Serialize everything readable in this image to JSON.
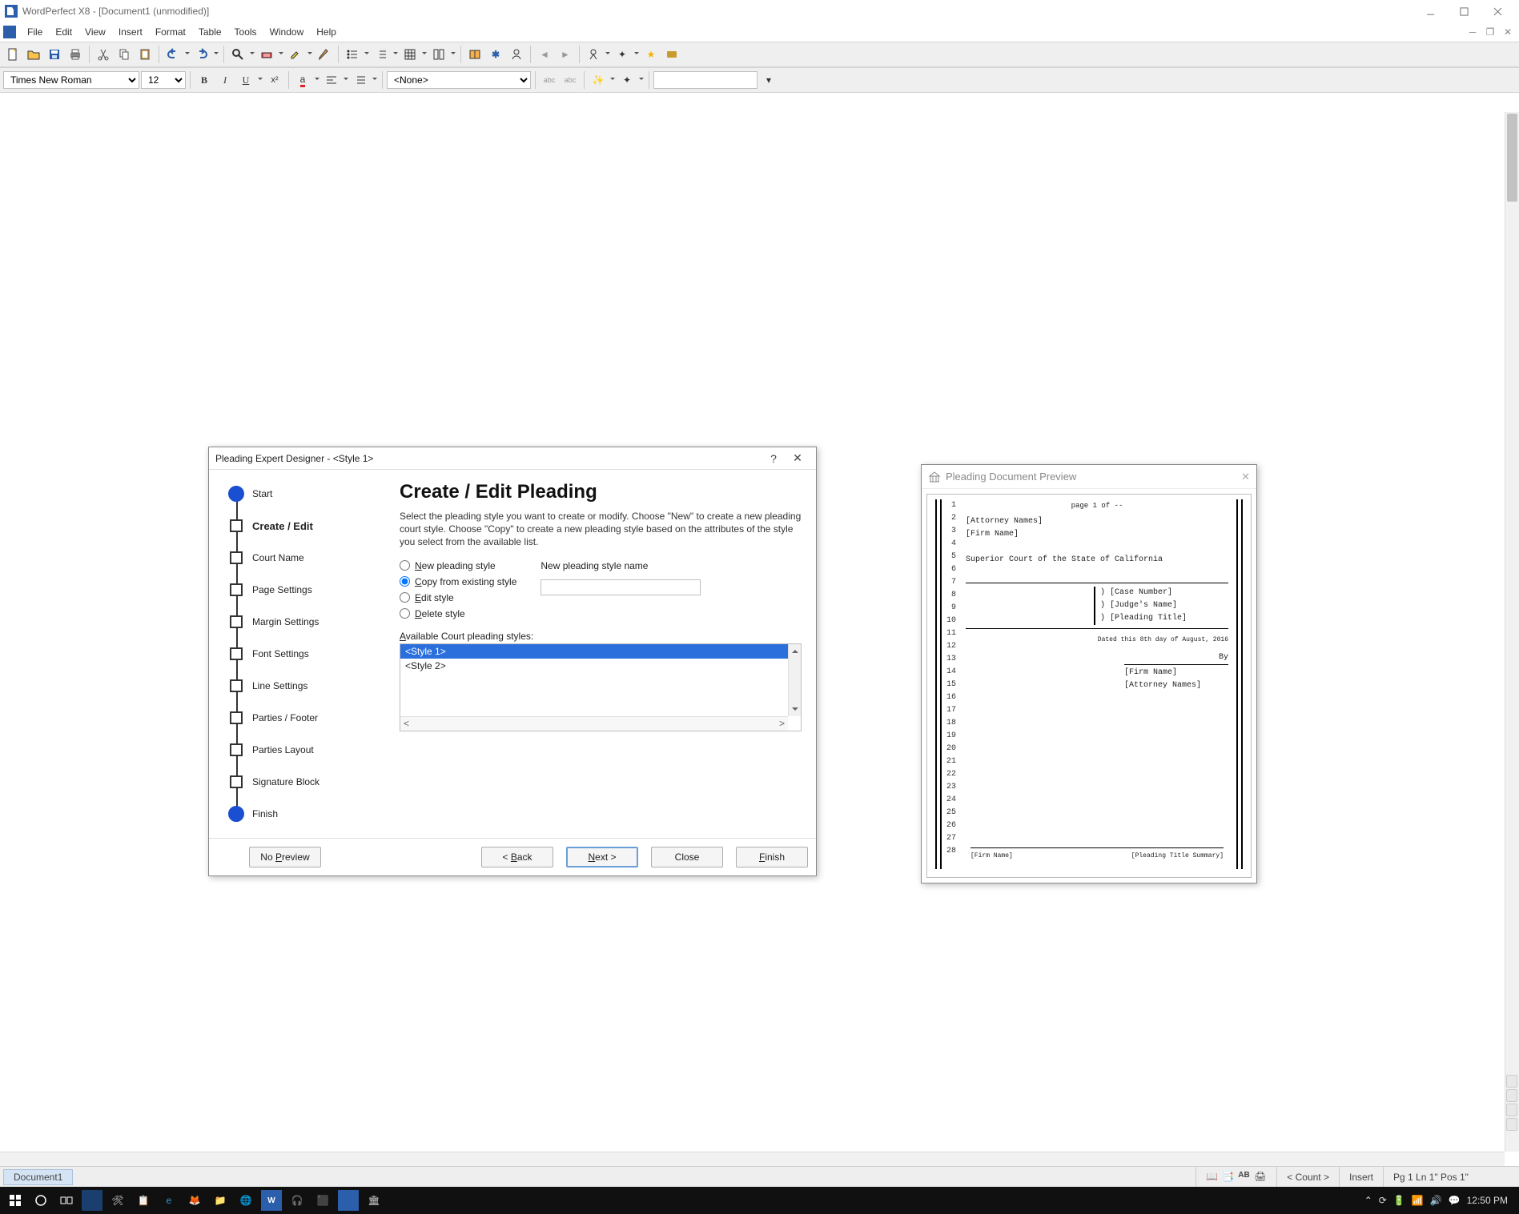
{
  "window": {
    "title": "WordPerfect X8 - [Document1 (unmodified)]"
  },
  "menu": {
    "items": [
      "File",
      "Edit",
      "View",
      "Insert",
      "Format",
      "Table",
      "Tools",
      "Window",
      "Help"
    ]
  },
  "toolbar2": {
    "font": "Times New Roman",
    "size": "12",
    "style_selected": "<None>"
  },
  "status": {
    "doc_tab": "Document1",
    "count": "< Count >",
    "mode": "Insert",
    "pos": "Pg 1 Ln 1\" Pos 1\""
  },
  "dialog": {
    "title": "Pleading Expert Designer - <Style 1>",
    "nav": [
      "Start",
      "Create / Edit",
      "Court Name",
      "Page Settings",
      "Margin Settings",
      "Font Settings",
      "Line Settings",
      "Parties / Footer",
      "Parties Layout",
      "Signature Block",
      "Finish"
    ],
    "nav_current_index": 1,
    "heading": "Create / Edit Pleading",
    "blurb": "Select the pleading style you want to create or modify. Choose \"New\" to create a new pleading court style.  Choose \"Copy\" to create a new pleading style based on the attributes of the style you select from the available list.",
    "radios": {
      "new": "New pleading style",
      "copy": "Copy from existing style",
      "edit": "Edit style",
      "delete": "Delete style",
      "selected": "copy"
    },
    "name_label": "New pleading style name",
    "name_value": "",
    "list_label": "Available Court pleading styles:",
    "list_items": [
      "<Style 1>",
      "<Style 2>"
    ],
    "list_selected_index": 0,
    "buttons": {
      "no_preview": "No Preview",
      "back": "< Back",
      "next": "Next >",
      "close": "Close",
      "finish": "Finish"
    }
  },
  "preview": {
    "title": "Pleading Document Preview",
    "page_label": "page 1 of --",
    "lines": {
      "attorney": "[Attorney Names]",
      "firm": "[Firm Name]",
      "court": "Superior Court of the State of California",
      "case": "[Case Number]",
      "judge": "[Judge's Name]",
      "ptitle": "[Pleading Title]",
      "dated": "Dated this 8th day of August, 2016",
      "by": "By",
      "sig_firm": "[Firm Name]",
      "sig_att": "[Attorney Names]",
      "foot_left": "[Firm Name]",
      "foot_right": "[Pleading Title Summary]"
    },
    "line_count": 28
  },
  "taskbar": {
    "clock": "12:50 PM"
  }
}
